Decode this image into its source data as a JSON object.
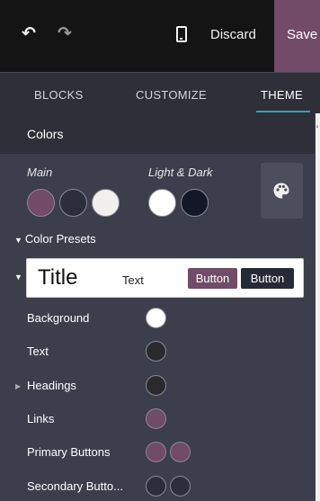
{
  "toolbar": {
    "undo_icon": "↶",
    "redo_icon": "↷",
    "discard_label": "Discard",
    "save_label": "Save",
    "device_icon": "mobile-icon"
  },
  "tabs": [
    {
      "label": "BLOCKS"
    },
    {
      "label": "CUSTOMIZE"
    },
    {
      "label": "THEME"
    }
  ],
  "active_tab": "THEME",
  "colors_section": {
    "title": "Colors",
    "main_label": "Main",
    "light_dark_label": "Light & Dark",
    "main_swatches": [
      "#714b67",
      "#2c2e3c",
      "#f2f0ec"
    ],
    "light_dark_swatches": [
      "#ffffff",
      "#111827"
    ],
    "palette_icon": "palette-icon"
  },
  "presets": {
    "label": "Color Presets",
    "preview": {
      "title": "Title",
      "text": "Text",
      "button1": "Button",
      "button2": "Button"
    }
  },
  "rows": [
    {
      "label": "Background",
      "colors": [
        "#ffffff"
      ],
      "caret": false
    },
    {
      "label": "Text",
      "colors": [
        "#2a2a2e"
      ],
      "caret": false
    },
    {
      "label": "Headings",
      "colors": [
        "#2a2a2e"
      ],
      "caret": true
    },
    {
      "label": "Links",
      "colors": [
        "#714b67"
      ],
      "caret": false
    },
    {
      "label": "Primary Buttons",
      "colors": [
        "#714b67",
        "#714b67"
      ],
      "caret": false
    },
    {
      "label": "Secondary Butto...",
      "colors": [
        "#2c2e3c",
        "#2c2e3c"
      ],
      "caret": false
    }
  ],
  "theme": {
    "accent": "#714b67",
    "tab_underline": "#2fa3b8",
    "panel_bg": "#3c3e4b",
    "topbar_bg": "#141414"
  }
}
